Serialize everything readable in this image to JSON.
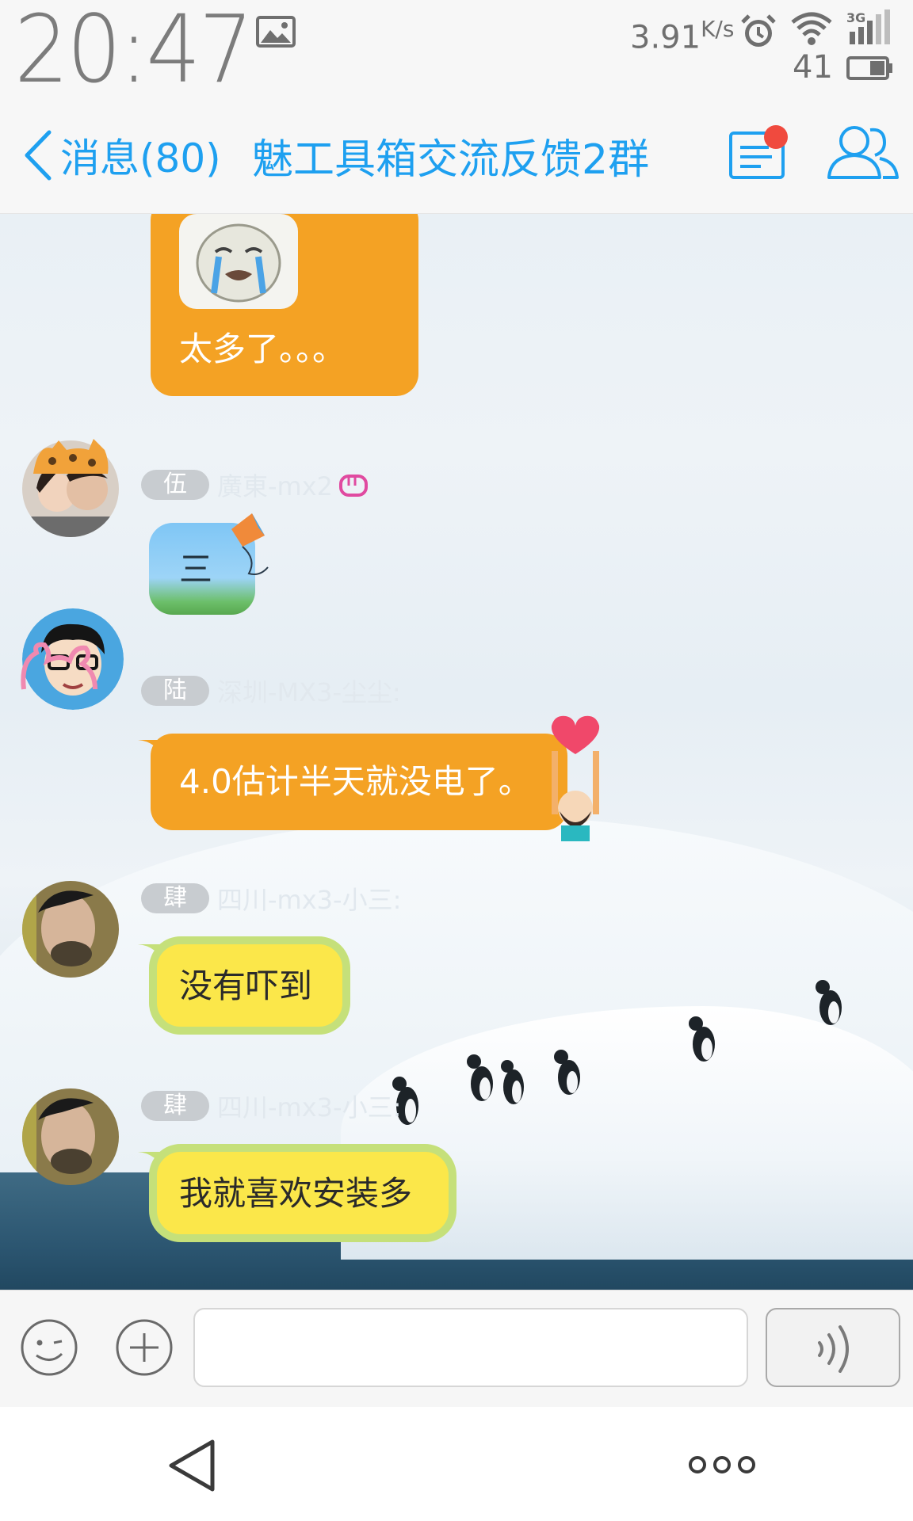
{
  "status_bar": {
    "time": "20:47",
    "net_speed": "3.91",
    "net_unit": "K/s",
    "battery": "41",
    "network_type": "3G"
  },
  "header": {
    "back_label": "消息(80)",
    "title": "魅工具箱交流反馈2群"
  },
  "messages": [
    {
      "text": "太多了。。。"
    },
    {
      "title": "伍",
      "sender": "廣東-mx2",
      "text": "三"
    },
    {
      "title": "陆",
      "sender": "深圳-MX3-尘尘:",
      "text": "4.0估计半天就没电了。"
    },
    {
      "title": "肆",
      "sender": "四川-mx3-小三:",
      "text": "没有吓到"
    },
    {
      "title": "肆",
      "sender": "四川-mx3-小三:",
      "text": "我就喜欢安装多"
    }
  ],
  "input": {
    "value": "",
    "placeholder": ""
  },
  "colors": {
    "accent": "#1ea0f0",
    "bubble_orange": "#f4a224",
    "bubble_yellow": "#fbe74a",
    "badge_red": "#f04a3e"
  },
  "icons": [
    "gallery-icon",
    "alarm-icon",
    "wifi-icon",
    "signal-icon",
    "battery-icon",
    "back-chevron-icon",
    "group-notice-icon",
    "group-members-icon",
    "emoji-icon",
    "plus-icon",
    "voice-icon",
    "nav-back-icon",
    "more-icon"
  ]
}
